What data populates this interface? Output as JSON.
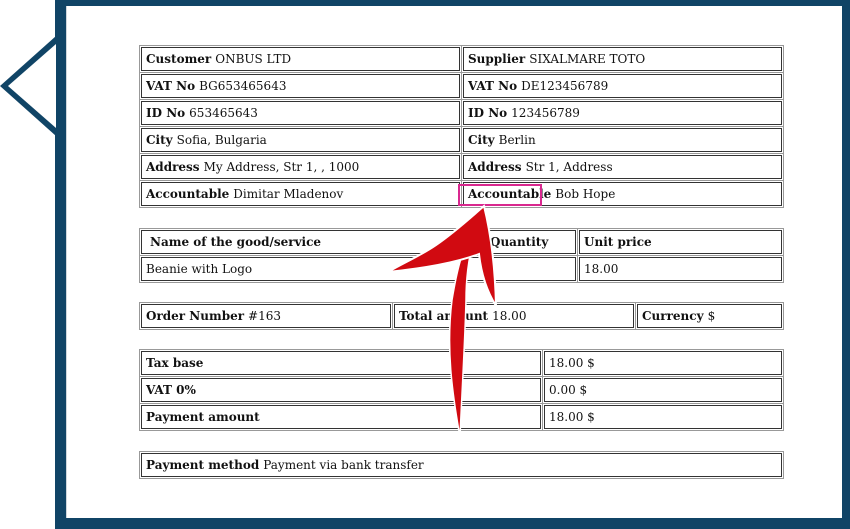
{
  "parties": {
    "customer": {
      "label": "Customer",
      "value": "ONBUS LTD"
    },
    "supplier": {
      "label": "Supplier",
      "value": "SIXALMARE TOTO"
    },
    "customer_vat": {
      "label": "VAT No",
      "value": "BG653465643"
    },
    "supplier_vat": {
      "label": "VAT No",
      "value": "DE123456789"
    },
    "customer_id": {
      "label": "ID No",
      "value": "653465643"
    },
    "supplier_id": {
      "label": "ID No",
      "value": "123456789"
    },
    "customer_city": {
      "label": "City",
      "value": "Sofia, Bulgaria"
    },
    "supplier_city": {
      "label": "City",
      "value": "Berlin"
    },
    "customer_address": {
      "label": "Address",
      "value": "My Address, Str 1, , 1000"
    },
    "supplier_address": {
      "label": "Address",
      "value": "Str 1, Address"
    },
    "customer_accountable": {
      "label": "Accountable",
      "value": "Dimitar Mladenov"
    },
    "supplier_accountable": {
      "label": "Accountable",
      "value": "Bob Hope"
    }
  },
  "goods": {
    "headers": {
      "name": "Name of the good/service",
      "quantity": "Quantity",
      "unit_price": "Unit price"
    },
    "rows": [
      {
        "name": "Beanie with Logo",
        "quantity": "",
        "unit_price": "18.00"
      }
    ]
  },
  "order": {
    "number_label": "Order Number",
    "number_value": "#163",
    "total_label": "Total amount",
    "total_value": "18.00",
    "currency_label": "Currency",
    "currency_value": "$"
  },
  "totals": [
    {
      "label": "Tax base",
      "value": "18.00 $"
    },
    {
      "label": "VAT 0%",
      "value": "0.00 $"
    },
    {
      "label": "Payment amount",
      "value": "18.00 $"
    }
  ],
  "payment": {
    "label": "Payment method",
    "value": "Payment via bank transfer"
  },
  "colors": {
    "frame": "#104466",
    "highlight": "#d9288f",
    "arrow": "#d10a11"
  }
}
